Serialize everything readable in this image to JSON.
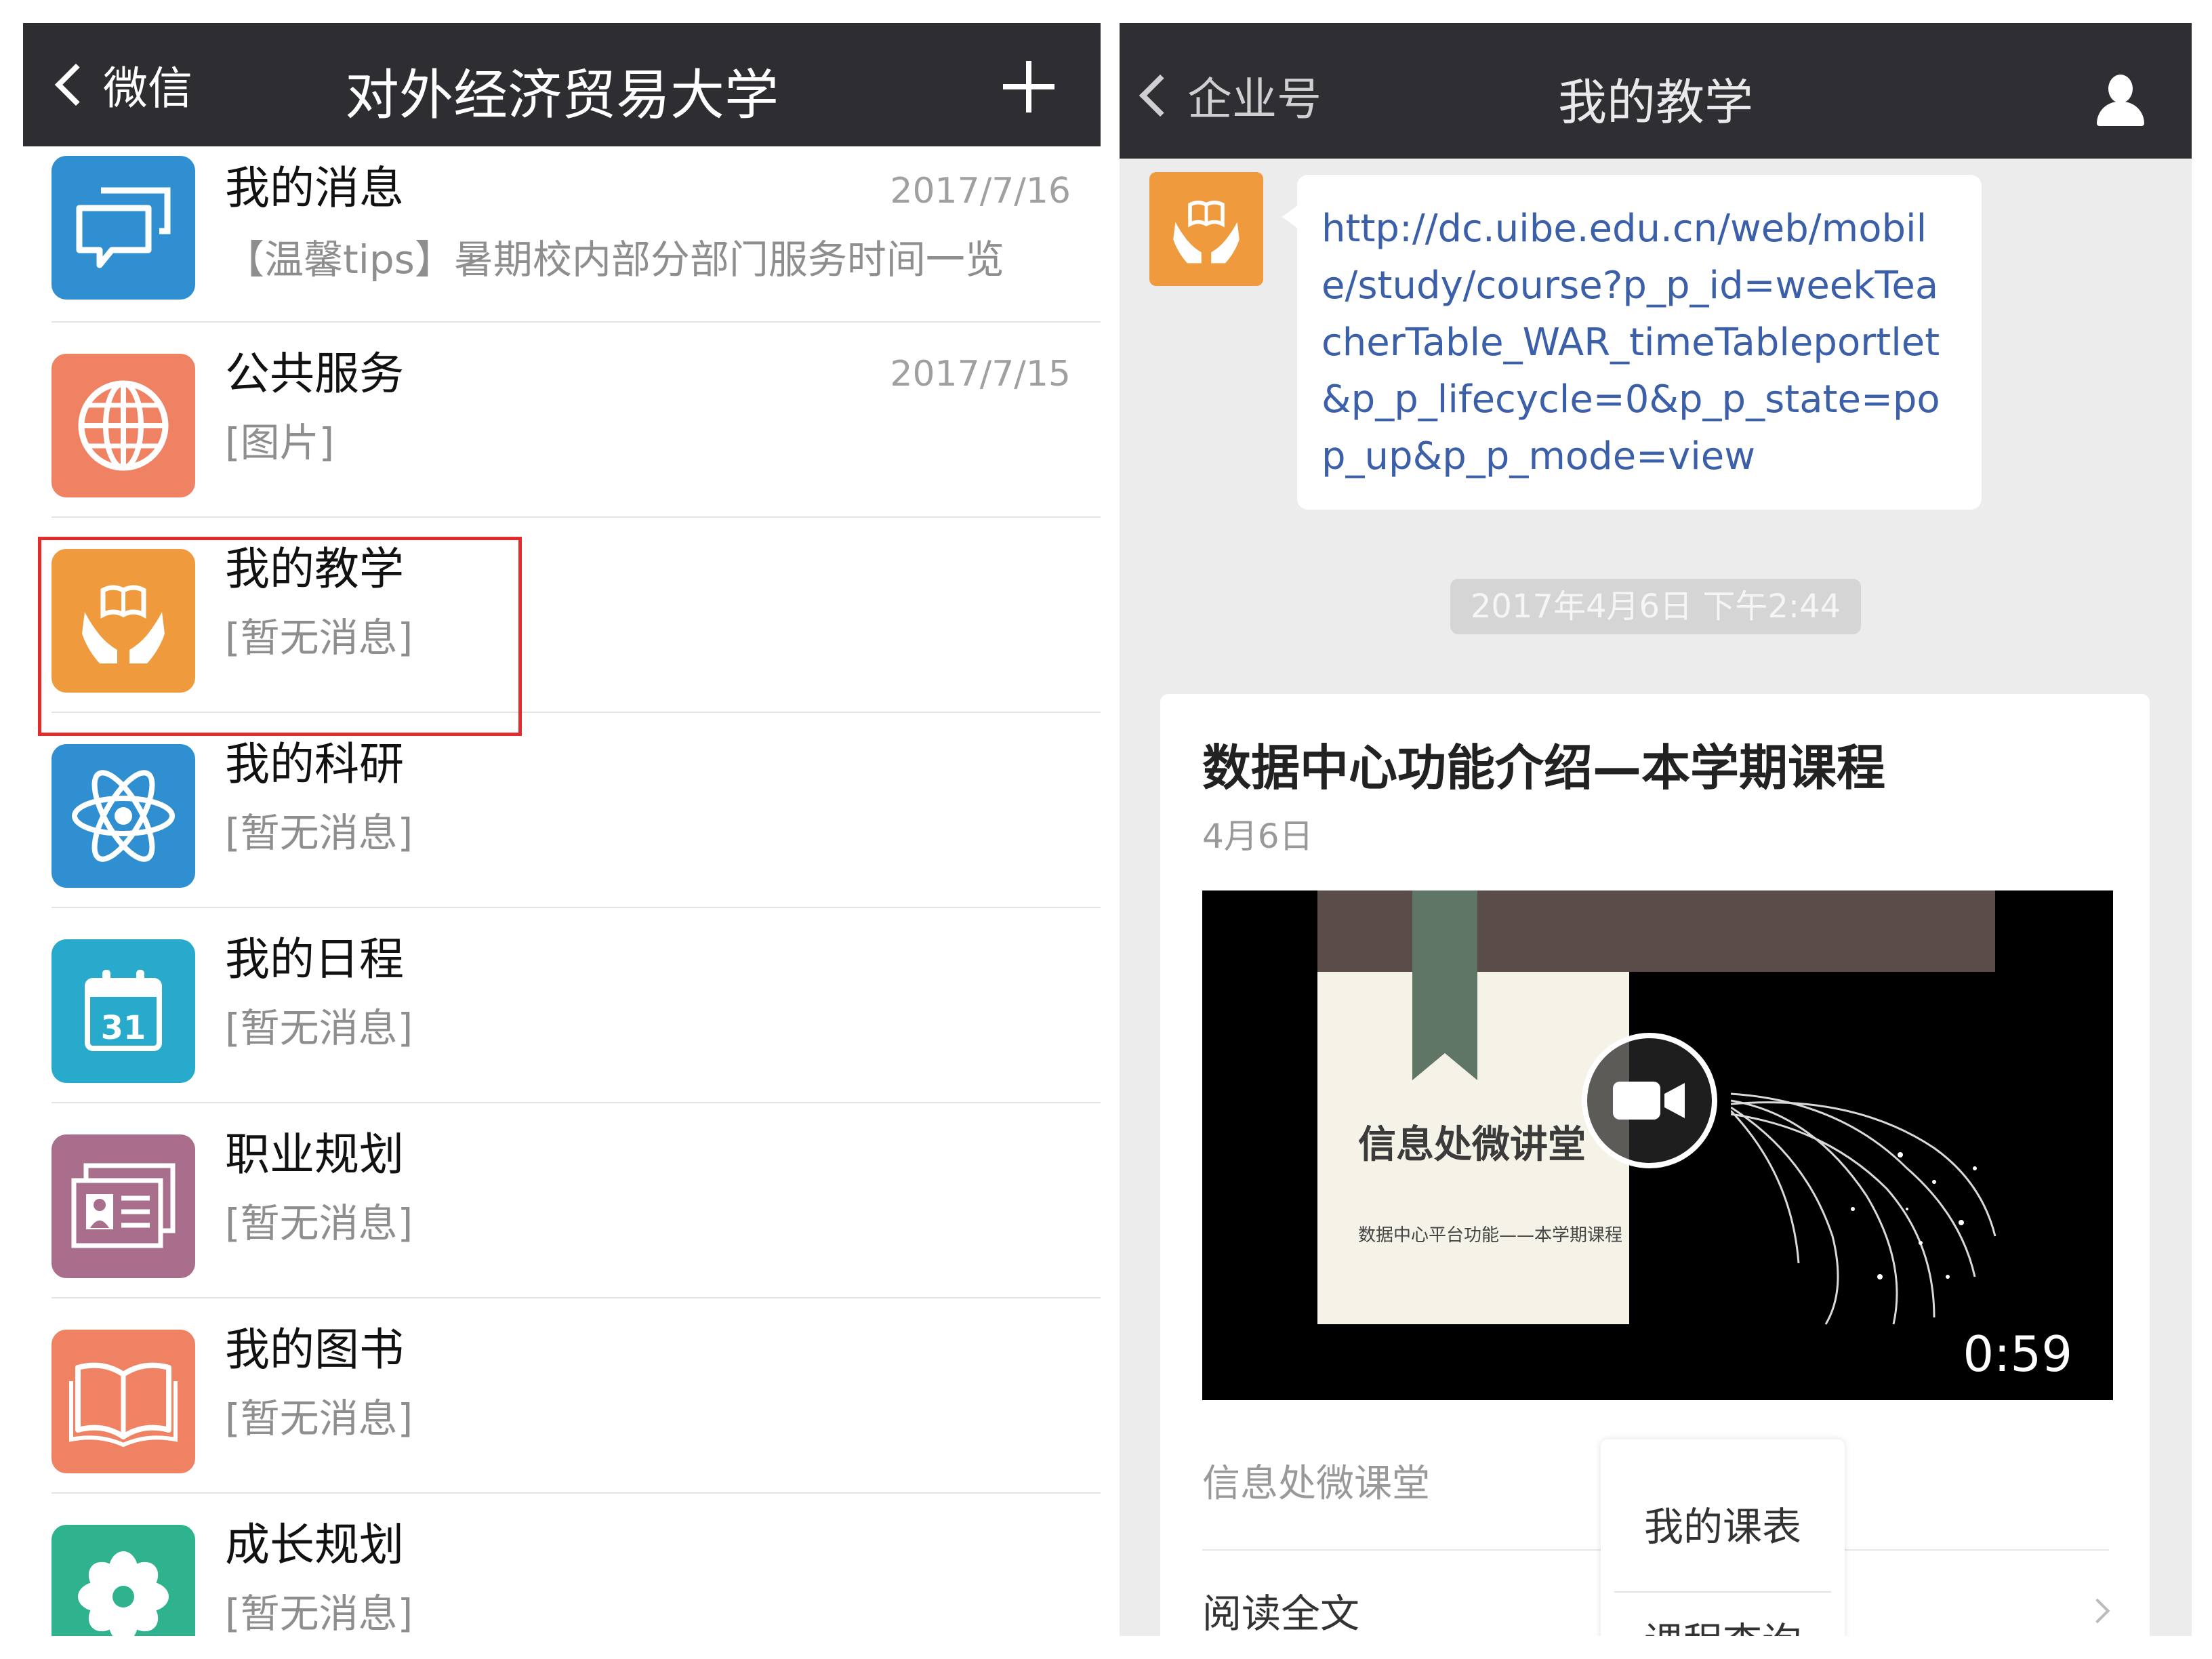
{
  "left_screen": {
    "nav": {
      "back_label": "微信",
      "title": "对外经济贸易大学"
    },
    "items": [
      {
        "name": "我的消息",
        "time": "2017/7/16",
        "preview": "【温馨tips】暑期校内部分部门服务时间一览",
        "icon": "chat-bubbles-icon",
        "color": "#2f8fd0"
      },
      {
        "name": "公共服务",
        "time": "2017/7/15",
        "preview": "[图片]",
        "icon": "globe-icon",
        "color": "#ef8263"
      },
      {
        "name": "我的教学",
        "time": "",
        "preview": "[暂无消息]",
        "icon": "hands-book-icon",
        "color": "#ef9a3d"
      },
      {
        "name": "我的科研",
        "time": "",
        "preview": "[暂无消息]",
        "icon": "atom-icon",
        "color": "#2f8fd0"
      },
      {
        "name": "我的日程",
        "time": "",
        "preview": "[暂无消息]",
        "icon": "calendar-icon",
        "color": "#27aacb"
      },
      {
        "name": "职业规划",
        "time": "",
        "preview": "[暂无消息]",
        "icon": "id-card-icon",
        "color": "#a86e8c"
      },
      {
        "name": "我的图书",
        "time": "",
        "preview": "[暂无消息]",
        "icon": "open-book-icon",
        "color": "#ef8263"
      },
      {
        "name": "成长规划",
        "time": "",
        "preview": "[暂无消息]",
        "icon": "flower-icon",
        "color": "#2fb38e"
      }
    ],
    "calendar_day": "31",
    "highlight_color": "#e32b2b"
  },
  "right_screen": {
    "nav": {
      "back_label": "企业号",
      "title": "我的教学"
    },
    "message_link": "http://dc.uibe.edu.cn/web/mobile/study/course?p_p_id=weekTeacherTable_WAR_timeTableportlet&p_p_lifecycle=0&p_p_state=pop_up&p_p_mode=view",
    "timestamp": "2017年4月6日 下午2:44",
    "article": {
      "title": "数据中心功能介绍—本学期课程",
      "date": "4月6日",
      "video_slide_title": "信息处微讲堂",
      "video_slide_subtitle": "数据中心平台功能——本学期课程",
      "video_duration": "0:59",
      "source": "信息处微课堂",
      "read_more": "阅读全文"
    },
    "popup_menu": [
      "我的课表",
      "课程查询"
    ]
  }
}
